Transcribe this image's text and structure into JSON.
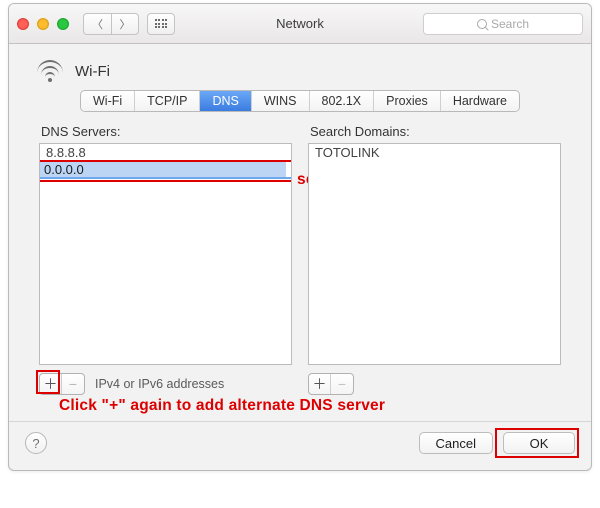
{
  "titlebar": {
    "title": "Network",
    "search_placeholder": "Search"
  },
  "interface": {
    "name": "Wi-Fi"
  },
  "tabs": {
    "items": [
      "Wi-Fi",
      "TCP/IP",
      "DNS",
      "WINS",
      "802.1X",
      "Proxies",
      "Hardware"
    ],
    "active": "DNS"
  },
  "dns": {
    "label": "DNS Servers:",
    "entries": [
      "8.8.8.8"
    ],
    "editing_value": "0.0.0.0",
    "hint": "IPv4 or IPv6 addresses",
    "add_glyph": "＋",
    "remove_glyph": "−"
  },
  "search_domains": {
    "label": "Search Domains:",
    "entries": [
      "TOTOLINK"
    ],
    "add_glyph": "＋",
    "remove_glyph": "−"
  },
  "annotations": {
    "line1": "Enter IP address of alternate DNS server",
    "line2": "Click \"+\" again to add alternate DNS server"
  },
  "footer": {
    "help": "?",
    "cancel": "Cancel",
    "ok": "OK"
  }
}
